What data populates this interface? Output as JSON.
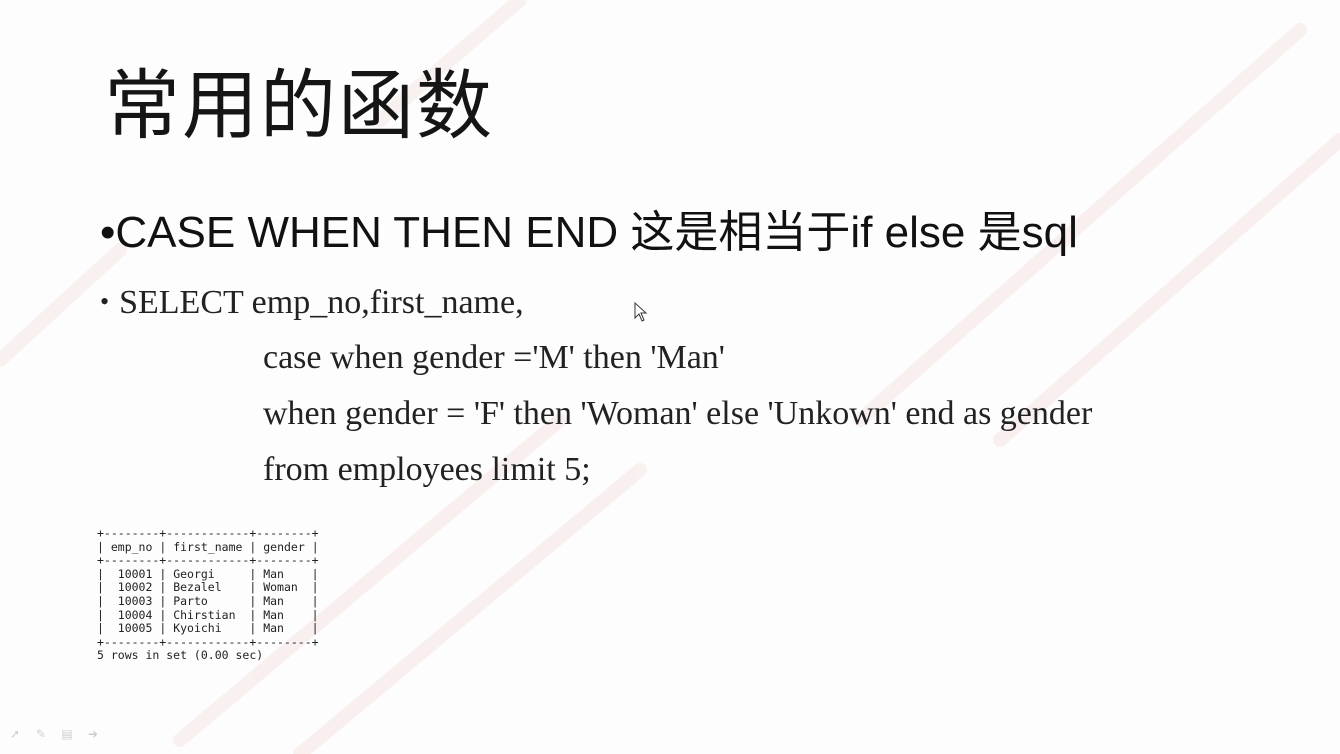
{
  "slide": {
    "title": "常用的函数",
    "bullet1": {
      "marker": "•",
      "text": "CASE WHEN THEN END 这是相当于if else 是sql"
    },
    "bullet2": {
      "marker": "•",
      "text": "SELECT emp_no,first_name,"
    },
    "code_lines": [
      "case when gender ='M' then 'Man'",
      "when gender = 'F' then 'Woman'  else 'Unkown' end as gender",
      "from employees limit 5;"
    ],
    "result_table": {
      "border": "+--------+------------+--------+",
      "headers": [
        "emp_no",
        "first_name",
        "gender"
      ],
      "rows": [
        [
          "10001",
          "Georgi",
          "Man"
        ],
        [
          "10002",
          "Bezalel",
          "Woman"
        ],
        [
          "10003",
          "Parto",
          "Man"
        ],
        [
          "10004",
          "Chirstian",
          "Man"
        ],
        [
          "10005",
          "Kyoichi",
          "Man"
        ]
      ],
      "footer": "5 rows in set (0.00 sec)"
    }
  },
  "icons": {
    "cursor": "mouse-pointer-icon",
    "toolbar": [
      "pointer-icon",
      "pen-icon",
      "menu-icon",
      "navigate-icon"
    ]
  },
  "colors": {
    "background": "#fdfdfd",
    "text": "#111111",
    "watermark": "#e8a0a0"
  }
}
